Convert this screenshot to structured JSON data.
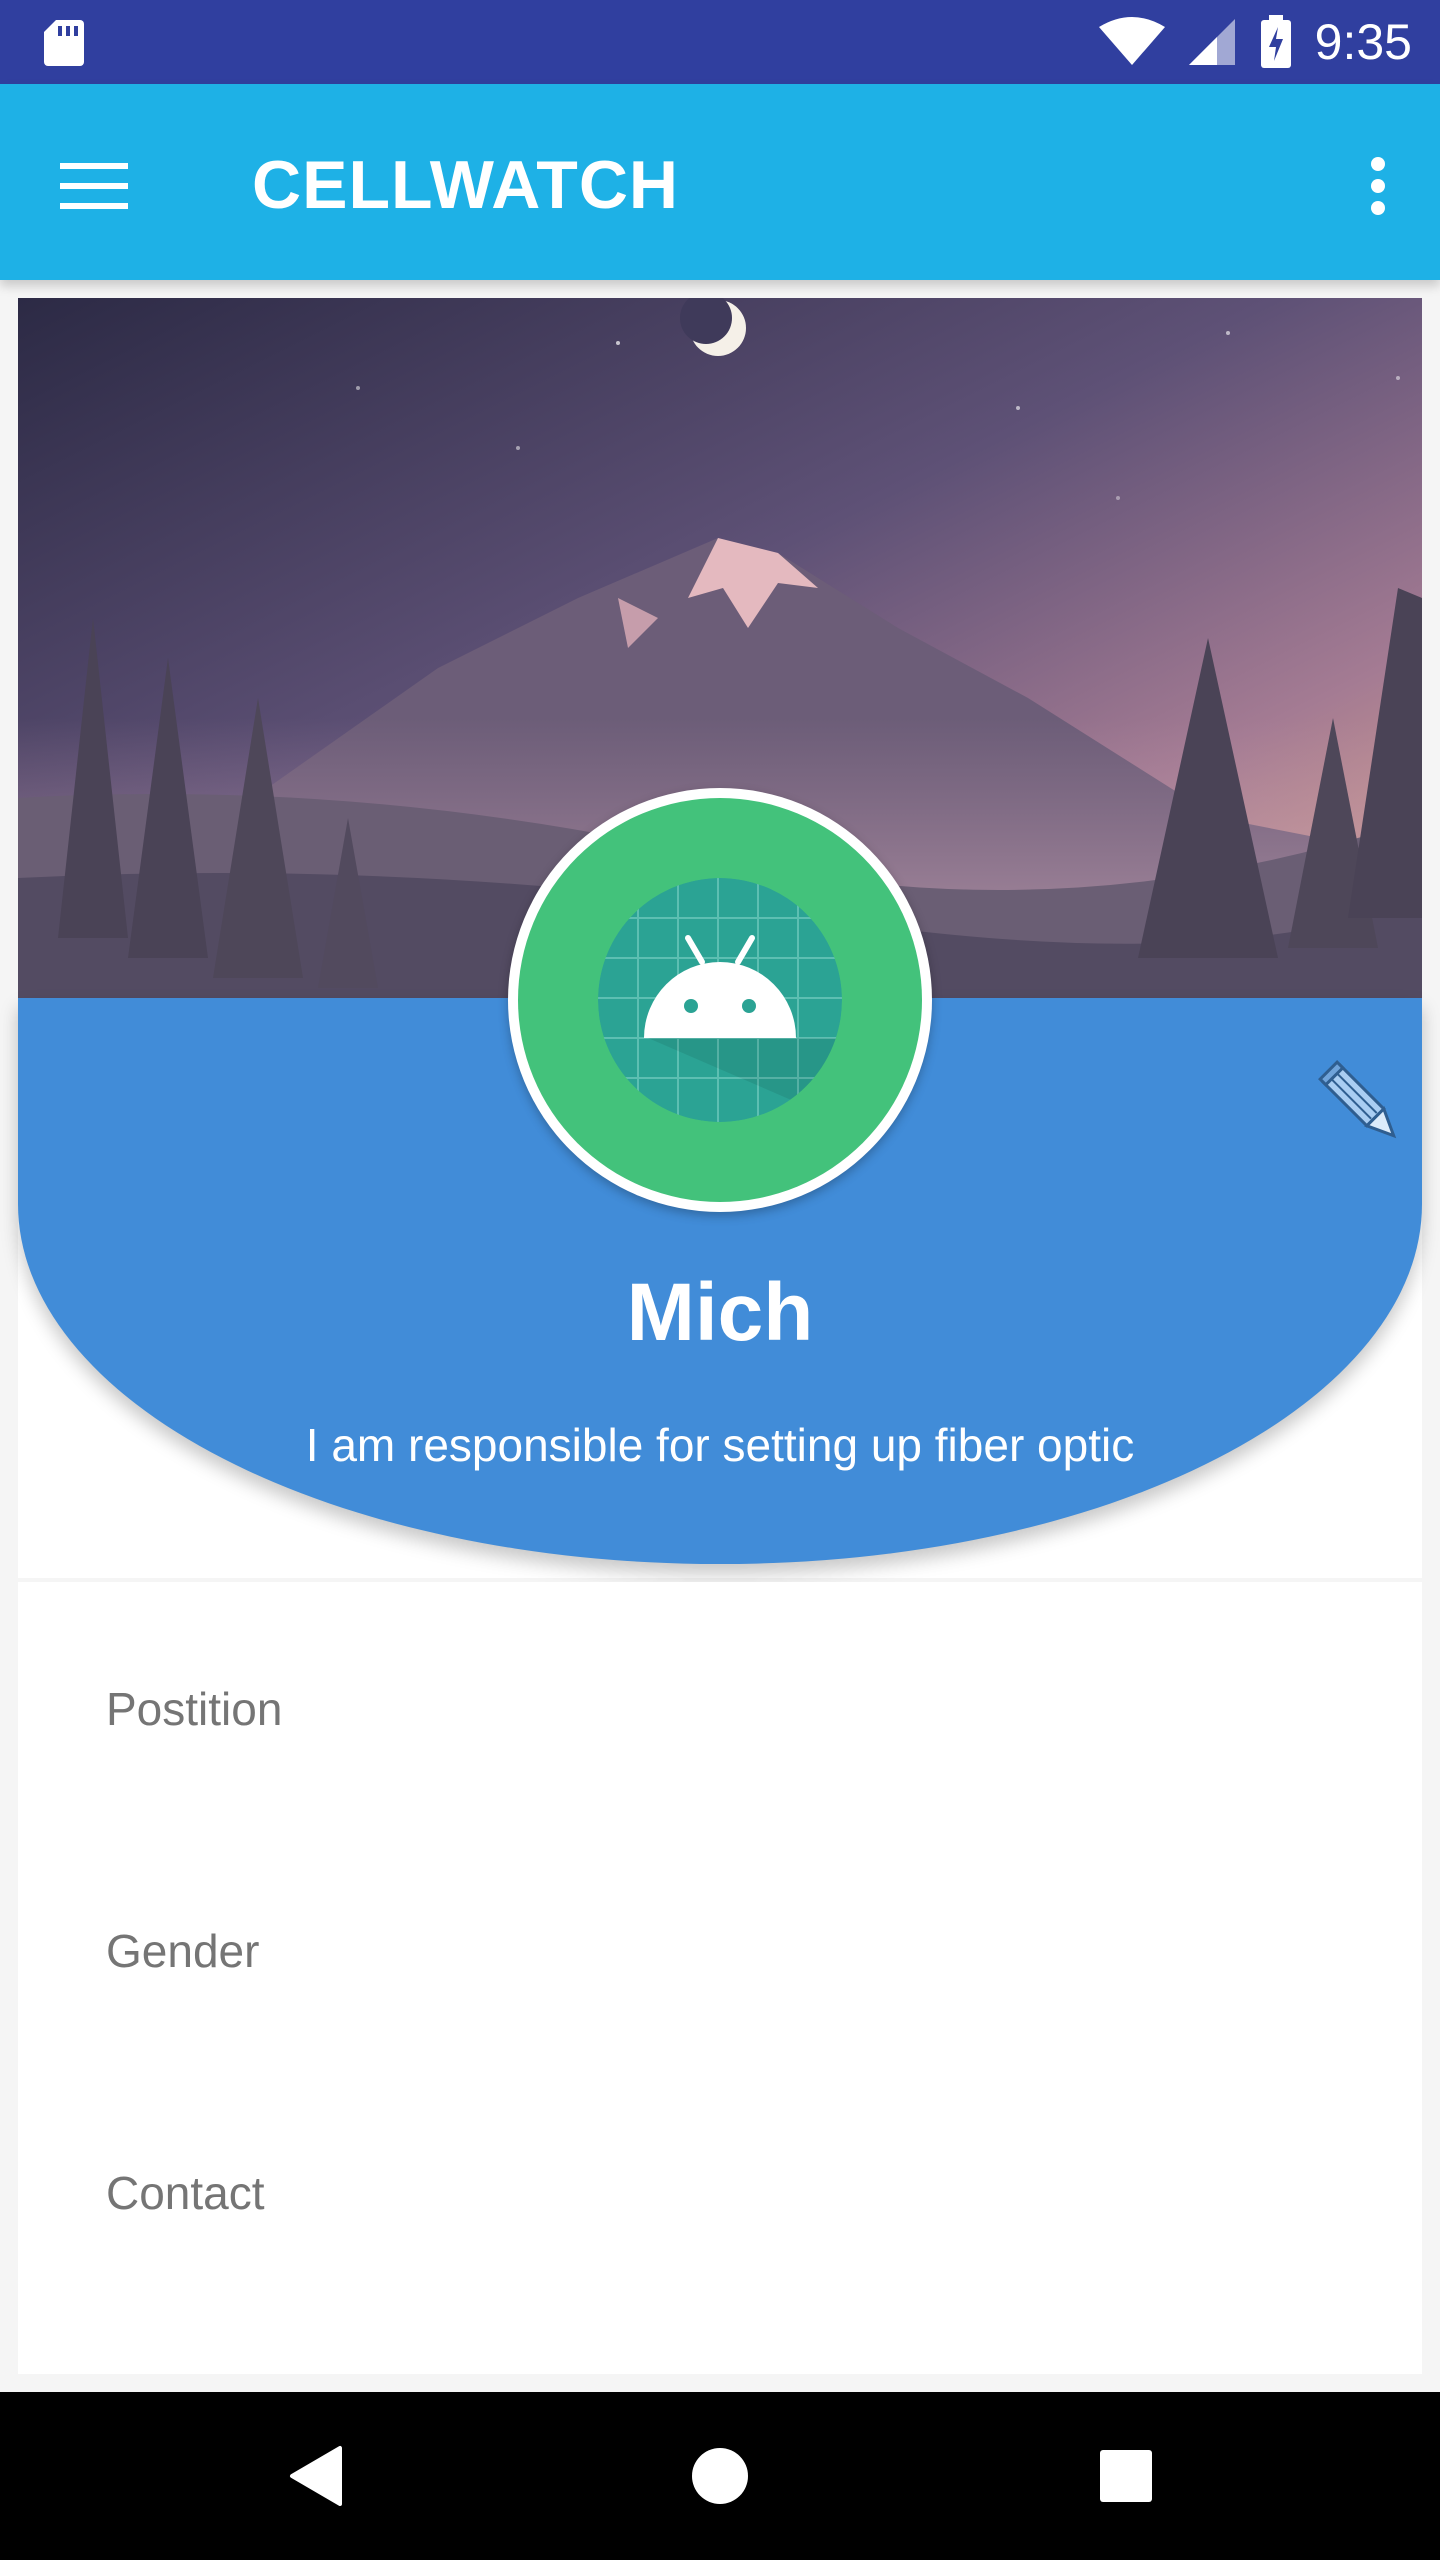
{
  "status_bar": {
    "time": "9:35",
    "icons": [
      "sd-card-icon",
      "wifi-icon",
      "cell-signal-icon",
      "battery-charging-icon"
    ]
  },
  "app_bar": {
    "title": "CELLWATCH",
    "menu_icon": "hamburger-menu-icon",
    "overflow_icon": "more-vert-icon"
  },
  "profile": {
    "name": "Mich",
    "bio": "I am responsible for setting up fiber optic",
    "avatar_icon": "android-icon",
    "edit_icon": "pencil-icon"
  },
  "details": {
    "position_label": "Postition",
    "gender_label": "Gender",
    "contact_label": "Contact"
  },
  "nav_bar": {
    "icons": [
      "back-icon",
      "home-icon",
      "recents-icon"
    ]
  },
  "colors": {
    "status_bar": "#303F9F",
    "app_bar": "#1EB1E6",
    "profile_blue": "#418CD8",
    "avatar_green": "#43C27B",
    "android_teal": "#2BA394"
  }
}
